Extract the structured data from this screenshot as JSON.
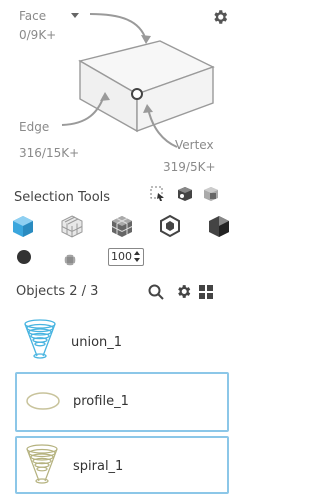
{
  "header": {
    "face_label": "Face",
    "face_count": "0/9K+",
    "edge_label": "Edge",
    "edge_count": "316/15K+",
    "vertex_label": "Vertex",
    "vertex_count": "319/5K+"
  },
  "selection_tools": {
    "title": "Selection Tools",
    "size_value": "100"
  },
  "objects": {
    "title": "Objects 2 / 3",
    "items": [
      {
        "label": "union_1",
        "selected": false
      },
      {
        "label": "profile_1",
        "selected": true
      },
      {
        "label": "spiral_1",
        "selected": true
      }
    ]
  },
  "colors": {
    "accent": "#8cc7e8",
    "tool_blue": "#3aa6dd",
    "icon_gray": "#555555"
  }
}
